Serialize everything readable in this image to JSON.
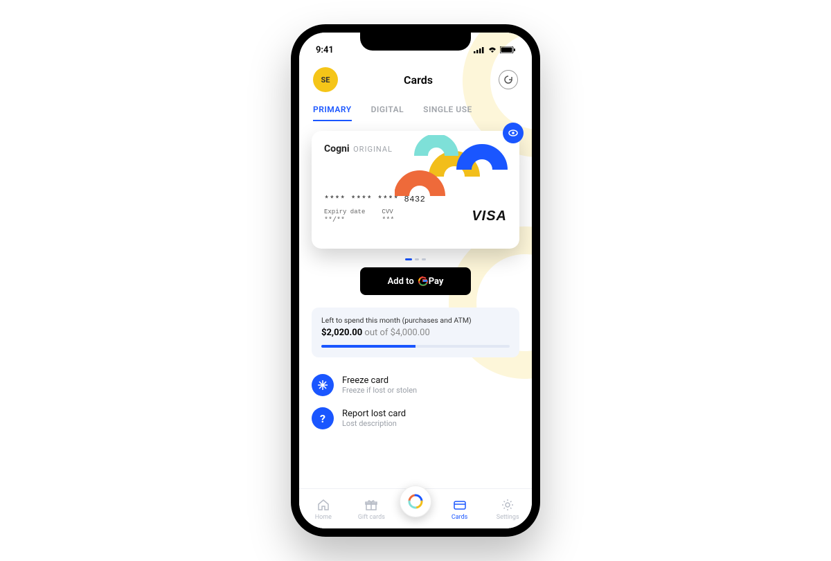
{
  "statusbar": {
    "time": "9:41"
  },
  "header": {
    "avatar_initials": "SE",
    "title": "Cards"
  },
  "tabs": [
    {
      "label": "PRIMARY",
      "active": true
    },
    {
      "label": "DIGITAL",
      "active": false
    },
    {
      "label": "SINGLE USE",
      "active": false
    }
  ],
  "card": {
    "brand": "Cogni",
    "variant": "ORIGINAL",
    "number_masked": "****  ****  ****  8432",
    "expiry_label": "Expiry date",
    "expiry_value": "**/**",
    "cvv_label": "CVV",
    "cvv_value": "***",
    "network": "VISA"
  },
  "gpay": {
    "prefix": "Add to",
    "suffix": "Pay"
  },
  "spend": {
    "label": "Left to spend this month (purchases and ATM)",
    "amount": "$2,020.00",
    "out_of_text": " out of ",
    "limit": "$4,000.00",
    "progress_pct": 50
  },
  "options": [
    {
      "icon": "snowflake",
      "title": "Freeze card",
      "desc": "Freeze if lost or stolen"
    },
    {
      "icon": "question",
      "title": "Report lost card",
      "desc": "Lost description"
    }
  ],
  "bottomnav": [
    {
      "label": "Home",
      "icon": "home"
    },
    {
      "label": "Gift cards",
      "icon": "gift"
    },
    {
      "label": "",
      "icon": "fab"
    },
    {
      "label": "Cards",
      "icon": "card",
      "active": true
    },
    {
      "label": "Settings",
      "icon": "gear"
    }
  ]
}
